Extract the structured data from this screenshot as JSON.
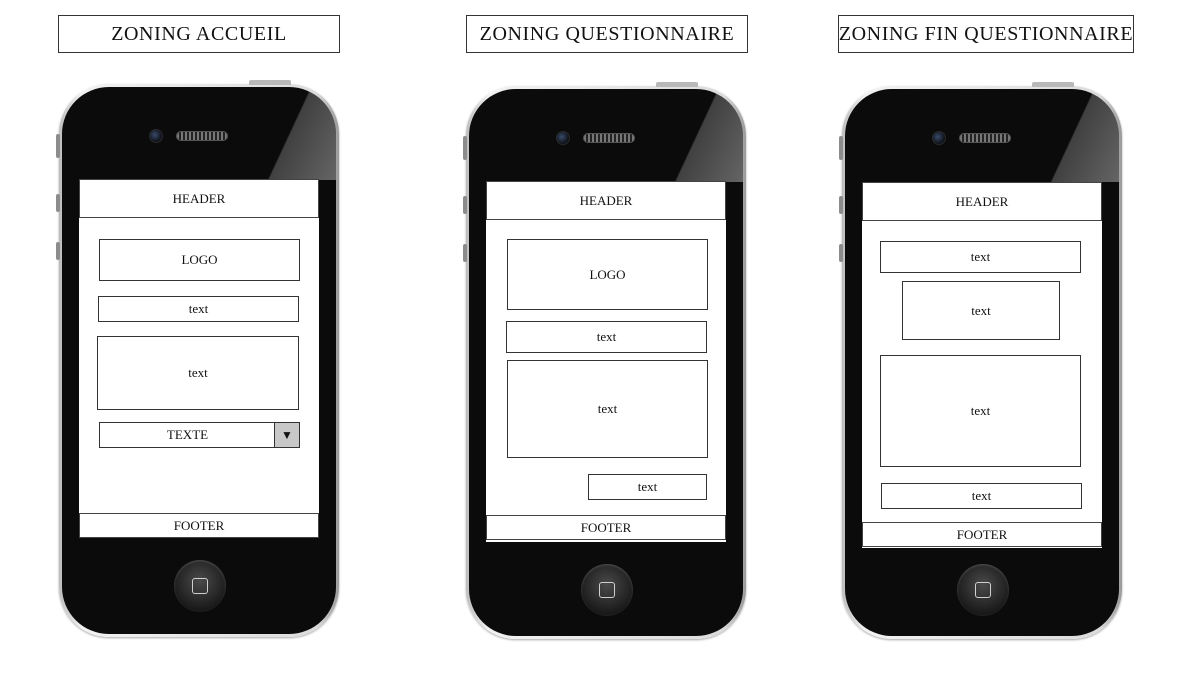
{
  "titles": {
    "accueil": "ZONING  ACCUEIL",
    "questionnaire": "ZONING  QUESTIONNAIRE",
    "fin": "ZONING  FIN  QUESTIONNAIRE"
  },
  "screens": {
    "accueil": {
      "header": "HEADER",
      "logo": "LOGO",
      "text1": "text",
      "text2": "text",
      "dropdown": {
        "value": "TEXTE",
        "arrow": "▼"
      },
      "footer": "FOOTER"
    },
    "questionnaire": {
      "header": "HEADER",
      "logo": "LOGO",
      "text1": "text",
      "text2": "text",
      "text3": "text",
      "footer": "FOOTER"
    },
    "fin": {
      "header": "HEADER",
      "text1": "text",
      "text2": "text",
      "text3": "text",
      "text4": "text",
      "footer": "FOOTER"
    }
  }
}
